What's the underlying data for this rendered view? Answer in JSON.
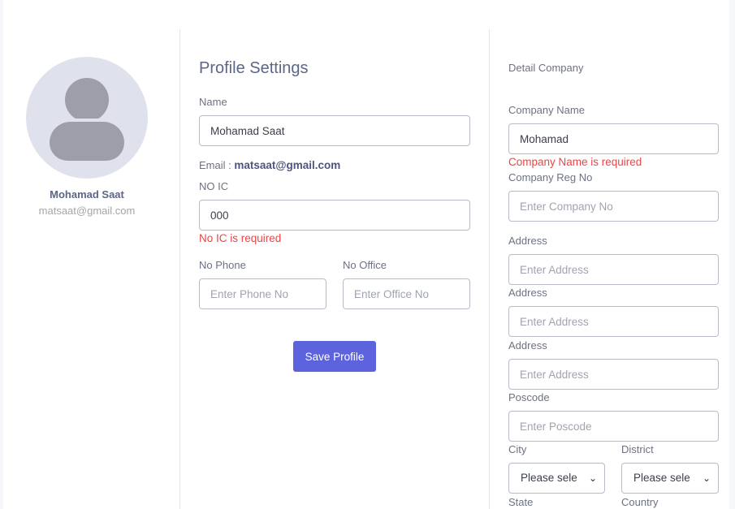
{
  "profile": {
    "name": "Mohamad Saat",
    "email": "matsaat@gmail.com"
  },
  "settings": {
    "title": "Profile Settings",
    "name_label": "Name",
    "name_value": "Mohamad Saat",
    "email_label": "Email : ",
    "email_value": "matsaat@gmail.com",
    "noic_label": "NO IC",
    "noic_value": "000",
    "noic_error": "No IC is required",
    "phone_label": "No Phone",
    "phone_placeholder": "Enter Phone No",
    "office_label": "No Office",
    "office_placeholder": "Enter Office No",
    "save_label": "Save Profile"
  },
  "company": {
    "title": "Detail Company",
    "name_label": "Company Name",
    "name_value": "Mohamad",
    "name_error": "Company Name is required",
    "reg_label": "Company Reg No",
    "reg_placeholder": "Enter Company No",
    "address1_label": "Address",
    "address1_placeholder": "Enter Address",
    "address2_label": "Address",
    "address2_placeholder": "Enter Address",
    "address3_label": "Address",
    "address3_placeholder": "Enter Address",
    "poscode_label": "Poscode",
    "poscode_placeholder": "Enter Poscode",
    "city_label": "City",
    "city_value": "Please select",
    "district_label": "District",
    "district_value": "Please select",
    "state_label": "State",
    "country_label": "Country"
  },
  "icons": {
    "avatar": "user-avatar-icon",
    "select_chevron": "chevron-down-icon"
  },
  "colors": {
    "primary": "#5c63dc",
    "error": "#ee4444",
    "heading": "#5d6589"
  }
}
